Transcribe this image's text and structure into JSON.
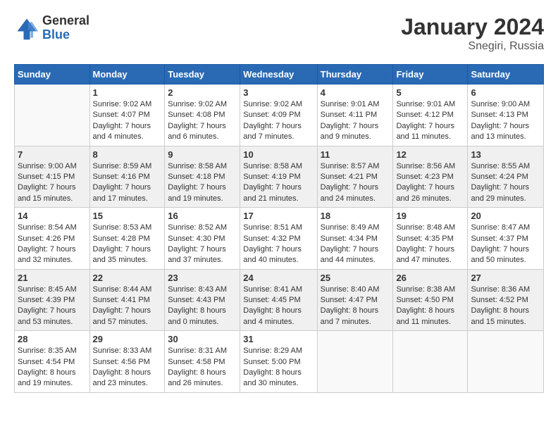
{
  "logo": {
    "general": "General",
    "blue": "Blue"
  },
  "title": "January 2024",
  "location": "Snegiri, Russia",
  "days_header": [
    "Sunday",
    "Monday",
    "Tuesday",
    "Wednesday",
    "Thursday",
    "Friday",
    "Saturday"
  ],
  "weeks": [
    [
      {
        "day": "",
        "empty": true
      },
      {
        "day": "1",
        "sunrise": "Sunrise: 9:02 AM",
        "sunset": "Sunset: 4:07 PM",
        "daylight": "Daylight: 7 hours and 4 minutes."
      },
      {
        "day": "2",
        "sunrise": "Sunrise: 9:02 AM",
        "sunset": "Sunset: 4:08 PM",
        "daylight": "Daylight: 7 hours and 6 minutes."
      },
      {
        "day": "3",
        "sunrise": "Sunrise: 9:02 AM",
        "sunset": "Sunset: 4:09 PM",
        "daylight": "Daylight: 7 hours and 7 minutes."
      },
      {
        "day": "4",
        "sunrise": "Sunrise: 9:01 AM",
        "sunset": "Sunset: 4:11 PM",
        "daylight": "Daylight: 7 hours and 9 minutes."
      },
      {
        "day": "5",
        "sunrise": "Sunrise: 9:01 AM",
        "sunset": "Sunset: 4:12 PM",
        "daylight": "Daylight: 7 hours and 11 minutes."
      },
      {
        "day": "6",
        "sunrise": "Sunrise: 9:00 AM",
        "sunset": "Sunset: 4:13 PM",
        "daylight": "Daylight: 7 hours and 13 minutes."
      }
    ],
    [
      {
        "day": "7",
        "sunrise": "Sunrise: 9:00 AM",
        "sunset": "Sunset: 4:15 PM",
        "daylight": "Daylight: 7 hours and 15 minutes."
      },
      {
        "day": "8",
        "sunrise": "Sunrise: 8:59 AM",
        "sunset": "Sunset: 4:16 PM",
        "daylight": "Daylight: 7 hours and 17 minutes."
      },
      {
        "day": "9",
        "sunrise": "Sunrise: 8:58 AM",
        "sunset": "Sunset: 4:18 PM",
        "daylight": "Daylight: 7 hours and 19 minutes."
      },
      {
        "day": "10",
        "sunrise": "Sunrise: 8:58 AM",
        "sunset": "Sunset: 4:19 PM",
        "daylight": "Daylight: 7 hours and 21 minutes."
      },
      {
        "day": "11",
        "sunrise": "Sunrise: 8:57 AM",
        "sunset": "Sunset: 4:21 PM",
        "daylight": "Daylight: 7 hours and 24 minutes."
      },
      {
        "day": "12",
        "sunrise": "Sunrise: 8:56 AM",
        "sunset": "Sunset: 4:23 PM",
        "daylight": "Daylight: 7 hours and 26 minutes."
      },
      {
        "day": "13",
        "sunrise": "Sunrise: 8:55 AM",
        "sunset": "Sunset: 4:24 PM",
        "daylight": "Daylight: 7 hours and 29 minutes."
      }
    ],
    [
      {
        "day": "14",
        "sunrise": "Sunrise: 8:54 AM",
        "sunset": "Sunset: 4:26 PM",
        "daylight": "Daylight: 7 hours and 32 minutes."
      },
      {
        "day": "15",
        "sunrise": "Sunrise: 8:53 AM",
        "sunset": "Sunset: 4:28 PM",
        "daylight": "Daylight: 7 hours and 35 minutes."
      },
      {
        "day": "16",
        "sunrise": "Sunrise: 8:52 AM",
        "sunset": "Sunset: 4:30 PM",
        "daylight": "Daylight: 7 hours and 37 minutes."
      },
      {
        "day": "17",
        "sunrise": "Sunrise: 8:51 AM",
        "sunset": "Sunset: 4:32 PM",
        "daylight": "Daylight: 7 hours and 40 minutes."
      },
      {
        "day": "18",
        "sunrise": "Sunrise: 8:49 AM",
        "sunset": "Sunset: 4:34 PM",
        "daylight": "Daylight: 7 hours and 44 minutes."
      },
      {
        "day": "19",
        "sunrise": "Sunrise: 8:48 AM",
        "sunset": "Sunset: 4:35 PM",
        "daylight": "Daylight: 7 hours and 47 minutes."
      },
      {
        "day": "20",
        "sunrise": "Sunrise: 8:47 AM",
        "sunset": "Sunset: 4:37 PM",
        "daylight": "Daylight: 7 hours and 50 minutes."
      }
    ],
    [
      {
        "day": "21",
        "sunrise": "Sunrise: 8:45 AM",
        "sunset": "Sunset: 4:39 PM",
        "daylight": "Daylight: 7 hours and 53 minutes."
      },
      {
        "day": "22",
        "sunrise": "Sunrise: 8:44 AM",
        "sunset": "Sunset: 4:41 PM",
        "daylight": "Daylight: 7 hours and 57 minutes."
      },
      {
        "day": "23",
        "sunrise": "Sunrise: 8:43 AM",
        "sunset": "Sunset: 4:43 PM",
        "daylight": "Daylight: 8 hours and 0 minutes."
      },
      {
        "day": "24",
        "sunrise": "Sunrise: 8:41 AM",
        "sunset": "Sunset: 4:45 PM",
        "daylight": "Daylight: 8 hours and 4 minutes."
      },
      {
        "day": "25",
        "sunrise": "Sunrise: 8:40 AM",
        "sunset": "Sunset: 4:47 PM",
        "daylight": "Daylight: 8 hours and 7 minutes."
      },
      {
        "day": "26",
        "sunrise": "Sunrise: 8:38 AM",
        "sunset": "Sunset: 4:50 PM",
        "daylight": "Daylight: 8 hours and 11 minutes."
      },
      {
        "day": "27",
        "sunrise": "Sunrise: 8:36 AM",
        "sunset": "Sunset: 4:52 PM",
        "daylight": "Daylight: 8 hours and 15 minutes."
      }
    ],
    [
      {
        "day": "28",
        "sunrise": "Sunrise: 8:35 AM",
        "sunset": "Sunset: 4:54 PM",
        "daylight": "Daylight: 8 hours and 19 minutes."
      },
      {
        "day": "29",
        "sunrise": "Sunrise: 8:33 AM",
        "sunset": "Sunset: 4:56 PM",
        "daylight": "Daylight: 8 hours and 23 minutes."
      },
      {
        "day": "30",
        "sunrise": "Sunrise: 8:31 AM",
        "sunset": "Sunset: 4:58 PM",
        "daylight": "Daylight: 8 hours and 26 minutes."
      },
      {
        "day": "31",
        "sunrise": "Sunrise: 8:29 AM",
        "sunset": "Sunset: 5:00 PM",
        "daylight": "Daylight: 8 hours and 30 minutes."
      },
      {
        "day": "",
        "empty": true
      },
      {
        "day": "",
        "empty": true
      },
      {
        "day": "",
        "empty": true
      }
    ]
  ]
}
